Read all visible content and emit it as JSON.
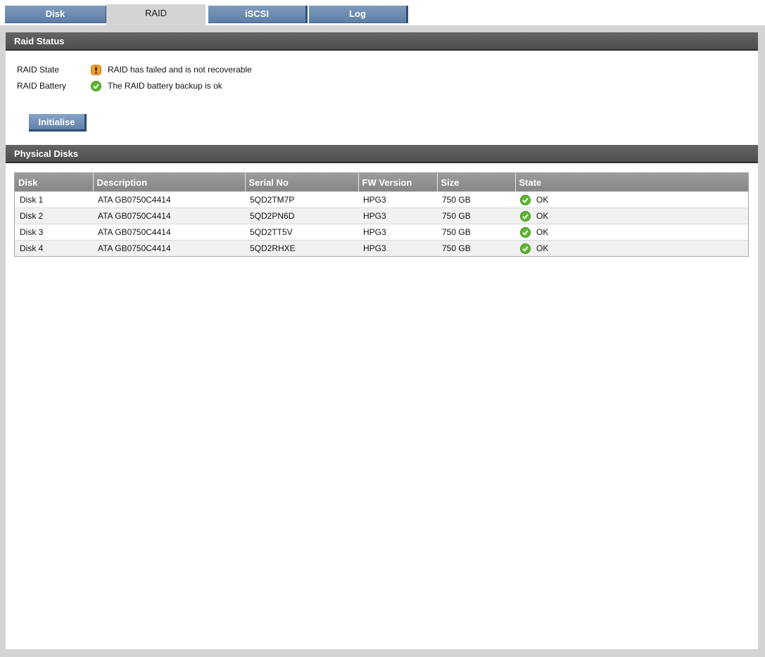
{
  "tabs": [
    {
      "label": "Disk",
      "active": false
    },
    {
      "label": "RAID",
      "active": true
    },
    {
      "label": "iSCSI",
      "active": false
    },
    {
      "label": "Log",
      "active": false
    }
  ],
  "raid_status": {
    "title": "Raid Status",
    "rows": [
      {
        "label": "RAID State",
        "icon": "warning-icon",
        "text": "RAID has failed and is not recoverable"
      },
      {
        "label": "RAID Battery",
        "icon": "ok-check-icon",
        "text": "The RAID battery backup is ok"
      }
    ],
    "initialise_label": "Initialise"
  },
  "physical_disks": {
    "title": "Physical Disks",
    "columns": [
      "Disk",
      "Description",
      "Serial No",
      "FW Version",
      "Size",
      "State"
    ],
    "rows": [
      {
        "disk": "Disk 1",
        "description": "ATA GB0750C4414",
        "serial": "5QD2TM7P",
        "fw": "HPG3",
        "size": "750 GB",
        "state": "OK"
      },
      {
        "disk": "Disk 2",
        "description": "ATA GB0750C4414",
        "serial": "5QD2PN6D",
        "fw": "HPG3",
        "size": "750 GB",
        "state": "OK"
      },
      {
        "disk": "Disk 3",
        "description": "ATA GB0750C4414",
        "serial": "5QD2TT5V",
        "fw": "HPG3",
        "size": "750 GB",
        "state": "OK"
      },
      {
        "disk": "Disk 4",
        "description": "ATA GB0750C4414",
        "serial": "5QD2RHXE",
        "fw": "HPG3",
        "size": "750 GB",
        "state": "OK"
      }
    ]
  },
  "colors": {
    "tab_blue": "#6b8ab1",
    "header_gray": "#555555",
    "ok_green": "#5cb82e",
    "warning_orange": "#f0a02a"
  }
}
